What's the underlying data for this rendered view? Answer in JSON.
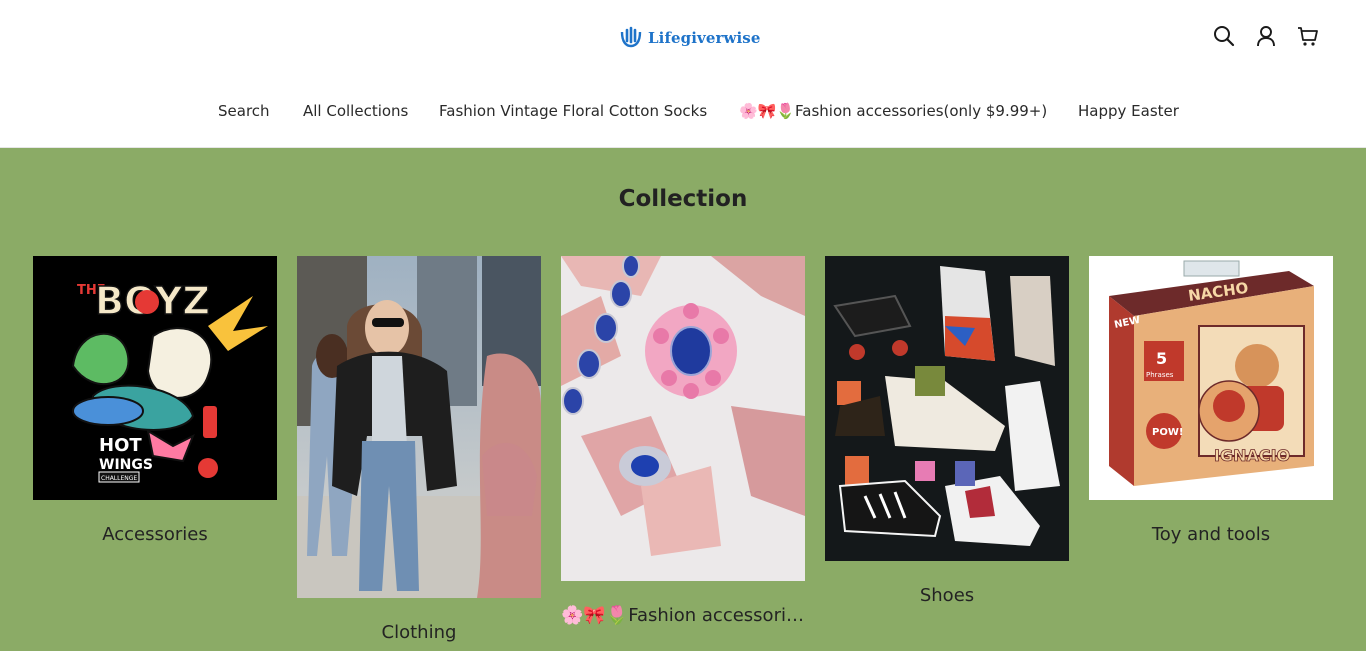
{
  "brand": {
    "name": "Lifegiverwise",
    "accent": "#1e73c9"
  },
  "header_icons": [
    "search-icon",
    "account-icon",
    "cart-icon"
  ],
  "nav": {
    "items": [
      {
        "label": "Search"
      },
      {
        "label": "All Collections"
      },
      {
        "label": "Fashion Vintage Floral Cotton Socks"
      },
      {
        "label": "🌸🎀🌷Fashion accessories(only $9.99+)"
      },
      {
        "label": "Happy Easter"
      }
    ]
  },
  "collection": {
    "title": "Collection",
    "background": "#8bab66",
    "cards": [
      {
        "label": "Accessories"
      },
      {
        "label": "Clothing"
      },
      {
        "label": "🌸🎀🌷Fashion accessories(only $9.99+)"
      },
      {
        "label": "Shoes"
      },
      {
        "label": "Toy and tools"
      }
    ]
  },
  "artwork_text": {
    "accessories": [
      "THE",
      "BOYZ",
      "HOT",
      "WINGS",
      "CHALLENGE"
    ],
    "toy": [
      "NACHO",
      "NEW",
      "5",
      "Phrases",
      "POW!",
      "IGNACIO"
    ]
  }
}
